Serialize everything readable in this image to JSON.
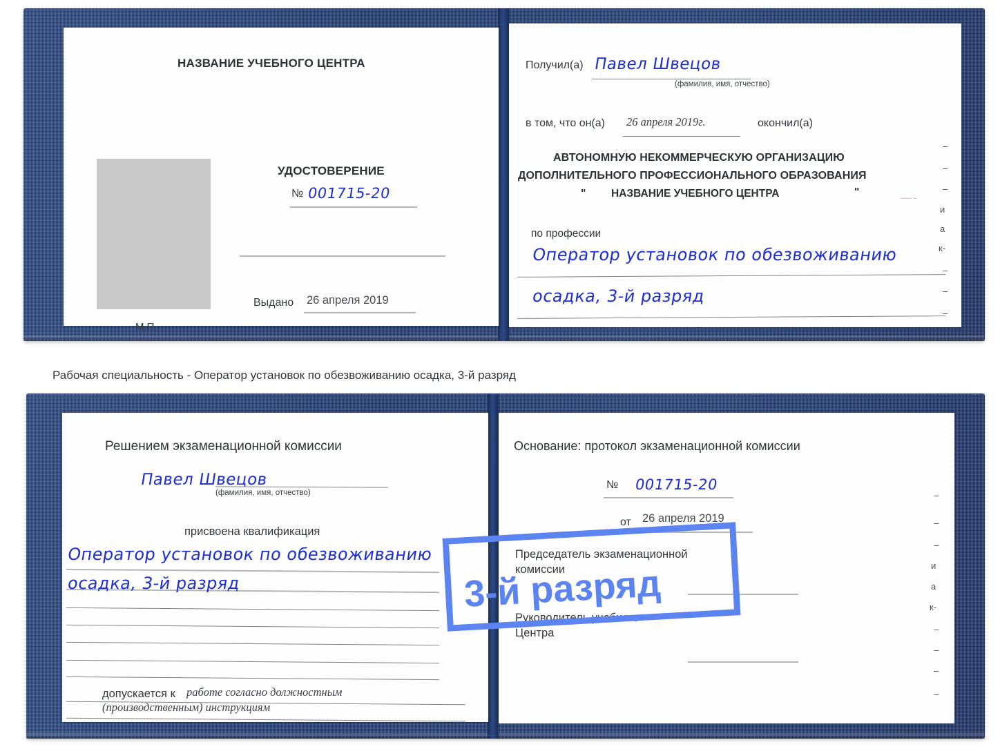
{
  "caption": "Рабочая специальность - Оператор установок по обезвоживанию осадка, 3-й разряд",
  "badge": {
    "label": "3-й разряд",
    "color": "#5b84f0"
  },
  "cover_color": "#24427c",
  "ink_color": "#1d2fd0",
  "certificate_top": {
    "left_page": {
      "center_name": "НАЗВАНИЕ УЧЕБНОГО ЦЕНТРА",
      "doc_title": "УДОСТОВЕРЕНИЕ",
      "number_label": "№",
      "number_value": "001715-20",
      "issued_label": "Выдано",
      "issued_value": "26 апреля 2019",
      "seal_label": "М.П.",
      "photo_placeholder": "photo-placeholder"
    },
    "right_page": {
      "received_label": "Получил(а)",
      "received_value": "Павел Швецов",
      "fio_hint": "(фамилия, имя, отчество)",
      "in_that_label": "в том, что он(а)",
      "completion_date": "26 апреля 2019г.",
      "finished_label": "окончил(а)",
      "org_line1": "АВТОНОМНУЮ НЕКОММЕРЧЕСКУЮ ОРГАНИЗАЦИЮ",
      "org_line2": "ДОПОЛНИТЕЛЬНОГО ПРОФЕССИОНАЛЬНОГО ОБРАЗОВАНИЯ",
      "org_quote_open": "\"",
      "org_line3": "НАЗВАНИЕ УЧЕБНОГО ЦЕНТРА",
      "org_quote_close": "\"",
      "profession_label": "по профессии",
      "profession_line1": "Оператор установок по обезвоживанию",
      "profession_line2": "осадка, 3-й разряд",
      "margin_marks": [
        "–",
        "–",
        "–",
        "и",
        "а",
        "к-",
        "–",
        "–",
        "–"
      ]
    }
  },
  "certificate_bottom": {
    "left_page": {
      "decision_title": "Решением экзаменационной комиссии",
      "name_value": "Павел Швецов",
      "fio_hint": "(фамилия, имя, отчество)",
      "qualification_label": "присвоена квалификация",
      "qualification_line1": "Оператор установок по обезвоживанию",
      "qualification_line2": "осадка, 3-й разряд",
      "admitted_label": "допускается к",
      "admitted_line1": "работе согласно должностным",
      "admitted_line2": "(производственным) инструкциям"
    },
    "right_page": {
      "basis_label": "Основание: протокол экзаменационной комиссии",
      "number_label": "№",
      "number_value": "001715-20",
      "from_label": "от",
      "from_value": "26 апреля 2019",
      "chairman_line1": "Председатель экзаменационной",
      "chairman_line2": "комиссии",
      "head_line1": "Руководитель учебного",
      "head_line2": "Центра",
      "margin_marks": [
        "–",
        "–",
        "–",
        "и",
        "а",
        "к-",
        "–",
        "–",
        "–",
        "–"
      ]
    }
  }
}
